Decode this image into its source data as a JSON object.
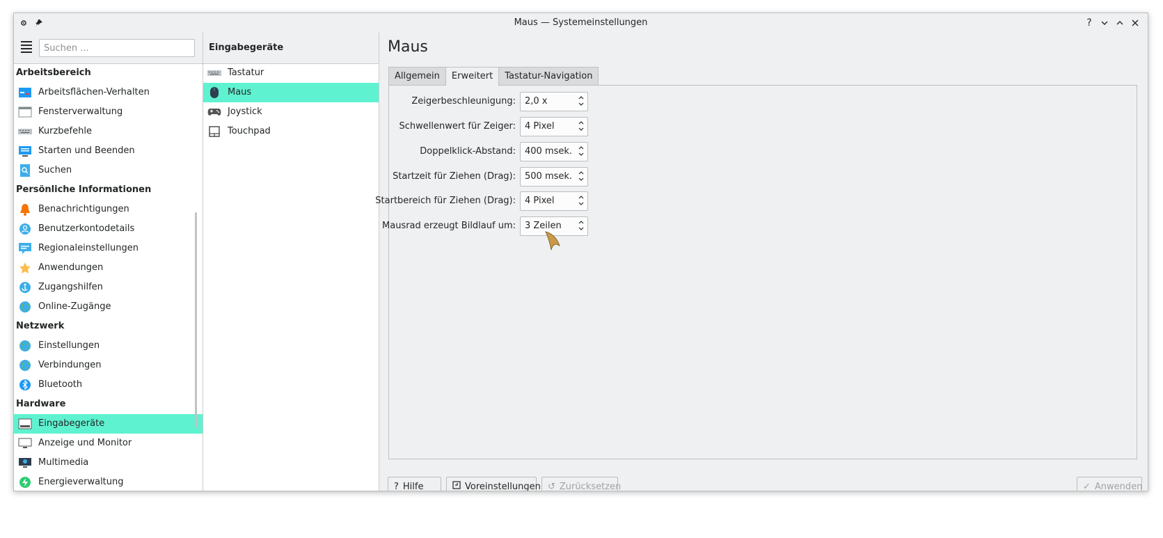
{
  "window": {
    "title": "Maus — Systemeinstellungen"
  },
  "titlebar_buttons": [
    "?",
    "⌄",
    "⌃",
    "✕"
  ],
  "sidebar": {
    "search_placeholder": "Suchen ...",
    "groups": [
      {
        "category": "Arbeitsbereich",
        "items": [
          {
            "label": "Arbeitsflächen-Verhalten",
            "icon": "workspace-behavior-icon"
          },
          {
            "label": "Fensterverwaltung",
            "icon": "window-management-icon"
          },
          {
            "label": "Kurzbefehle",
            "icon": "keyboard-shortcuts-icon"
          },
          {
            "label": "Starten und Beenden",
            "icon": "startup-shutdown-icon"
          },
          {
            "label": "Suchen",
            "icon": "search-icon"
          }
        ]
      },
      {
        "category": "Persönliche Informationen",
        "items": [
          {
            "label": "Benachrichtigungen",
            "icon": "bell-icon"
          },
          {
            "label": "Benutzerkontodetails",
            "icon": "user-account-icon"
          },
          {
            "label": "Regionaleinstellungen",
            "icon": "region-icon"
          },
          {
            "label": "Anwendungen",
            "icon": "star-icon"
          },
          {
            "label": "Zugangshilfen",
            "icon": "accessibility-icon"
          },
          {
            "label": "Online-Zugänge",
            "icon": "globe-icon"
          }
        ]
      },
      {
        "category": "Netzwerk",
        "items": [
          {
            "label": "Einstellungen",
            "icon": "globe-icon"
          },
          {
            "label": "Verbindungen",
            "icon": "globe-icon"
          },
          {
            "label": "Bluetooth",
            "icon": "bluetooth-icon"
          }
        ]
      },
      {
        "category": "Hardware",
        "items": [
          {
            "label": "Eingabegeräte",
            "icon": "input-devices-icon",
            "selected": true
          },
          {
            "label": "Anzeige und Monitor",
            "icon": "monitor-icon"
          },
          {
            "label": "Multimedia",
            "icon": "multimedia-icon"
          },
          {
            "label": "Energieverwaltung",
            "icon": "power-icon"
          }
        ]
      }
    ]
  },
  "middle": {
    "header": "Eingabegeräte",
    "items": [
      {
        "label": "Tastatur",
        "icon": "keyboard-icon"
      },
      {
        "label": "Maus",
        "icon": "mouse-icon",
        "selected": true
      },
      {
        "label": "Joystick",
        "icon": "gamepad-icon"
      },
      {
        "label": "Touchpad",
        "icon": "touchpad-icon"
      }
    ]
  },
  "content": {
    "title": "Maus",
    "tabs": [
      "Allgemein",
      "Erweitert",
      "Tastatur-Navigation"
    ],
    "active_tab": "Erweitert",
    "fields": [
      {
        "label": "Zeigerbeschleunigung:",
        "value": "2,0 x"
      },
      {
        "label": "Schwellenwert für Zeiger:",
        "value": "4 Pixel"
      },
      {
        "label": "Doppelklick-Abstand:",
        "value": "400 msek."
      },
      {
        "label": "Startzeit für Ziehen (Drag):",
        "value": "500 msek."
      },
      {
        "label": "Startbereich für Ziehen (Drag):",
        "value": "4 Pixel"
      },
      {
        "label": "Mausrad erzeugt Bildlauf um:",
        "value": "3 Zeilen"
      }
    ]
  },
  "buttons": {
    "help": "Hilfe",
    "defaults": "Voreinstellungen",
    "reset": "Zurücksetzen",
    "apply": "Anwenden"
  },
  "colors": {
    "selection": "#5ff2d1",
    "window_bg": "#eff0f1"
  }
}
